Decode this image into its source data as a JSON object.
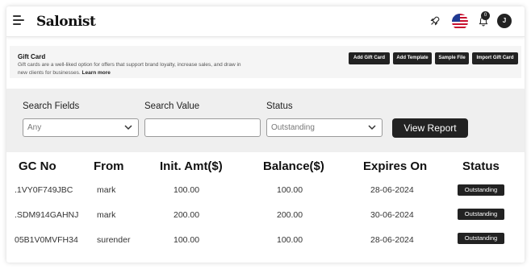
{
  "brand": "Salonist",
  "topbar": {
    "notification_count": "0",
    "avatar_initial": "J"
  },
  "header": {
    "title": "Gift Card",
    "description": "Gift cards are a well-liked option for offers that support brand loyalty, increase sales, and draw in new clients for businesses.",
    "learn_more": "Learn more",
    "buttons": [
      "Add Gift Card",
      "Add Template",
      "Sample File",
      "Import Gift Card"
    ]
  },
  "search": {
    "fields_label": "Search Fields",
    "fields_value": "Any",
    "value_label": "Search Value",
    "value_text": "",
    "status_label": "Status",
    "status_value": "Outstanding",
    "submit_label": "View Report"
  },
  "table": {
    "columns": [
      "GC No",
      "From",
      "Init. Amt($)",
      "Balance($)",
      "Expires On",
      "Status"
    ],
    "rows": [
      {
        "gc_no": ".1VY0F749JBC",
        "from": "mark",
        "init_amt": "100.00",
        "balance": "100.00",
        "expires": "28-06-2024",
        "status": "Outstanding"
      },
      {
        "gc_no": ".SDM914GAHNJ",
        "from": "mark",
        "init_amt": "200.00",
        "balance": "200.00",
        "expires": "30-06-2024",
        "status": "Outstanding"
      },
      {
        "gc_no": "05B1V0MVFH34",
        "from": "surender",
        "init_amt": "100.00",
        "balance": "100.00",
        "expires": "28-06-2024",
        "status": "Outstanding"
      }
    ]
  },
  "colors": {
    "primary_dark": "#222222",
    "panel_bg": "#efefef",
    "header_bg": "#f5f5f5"
  }
}
